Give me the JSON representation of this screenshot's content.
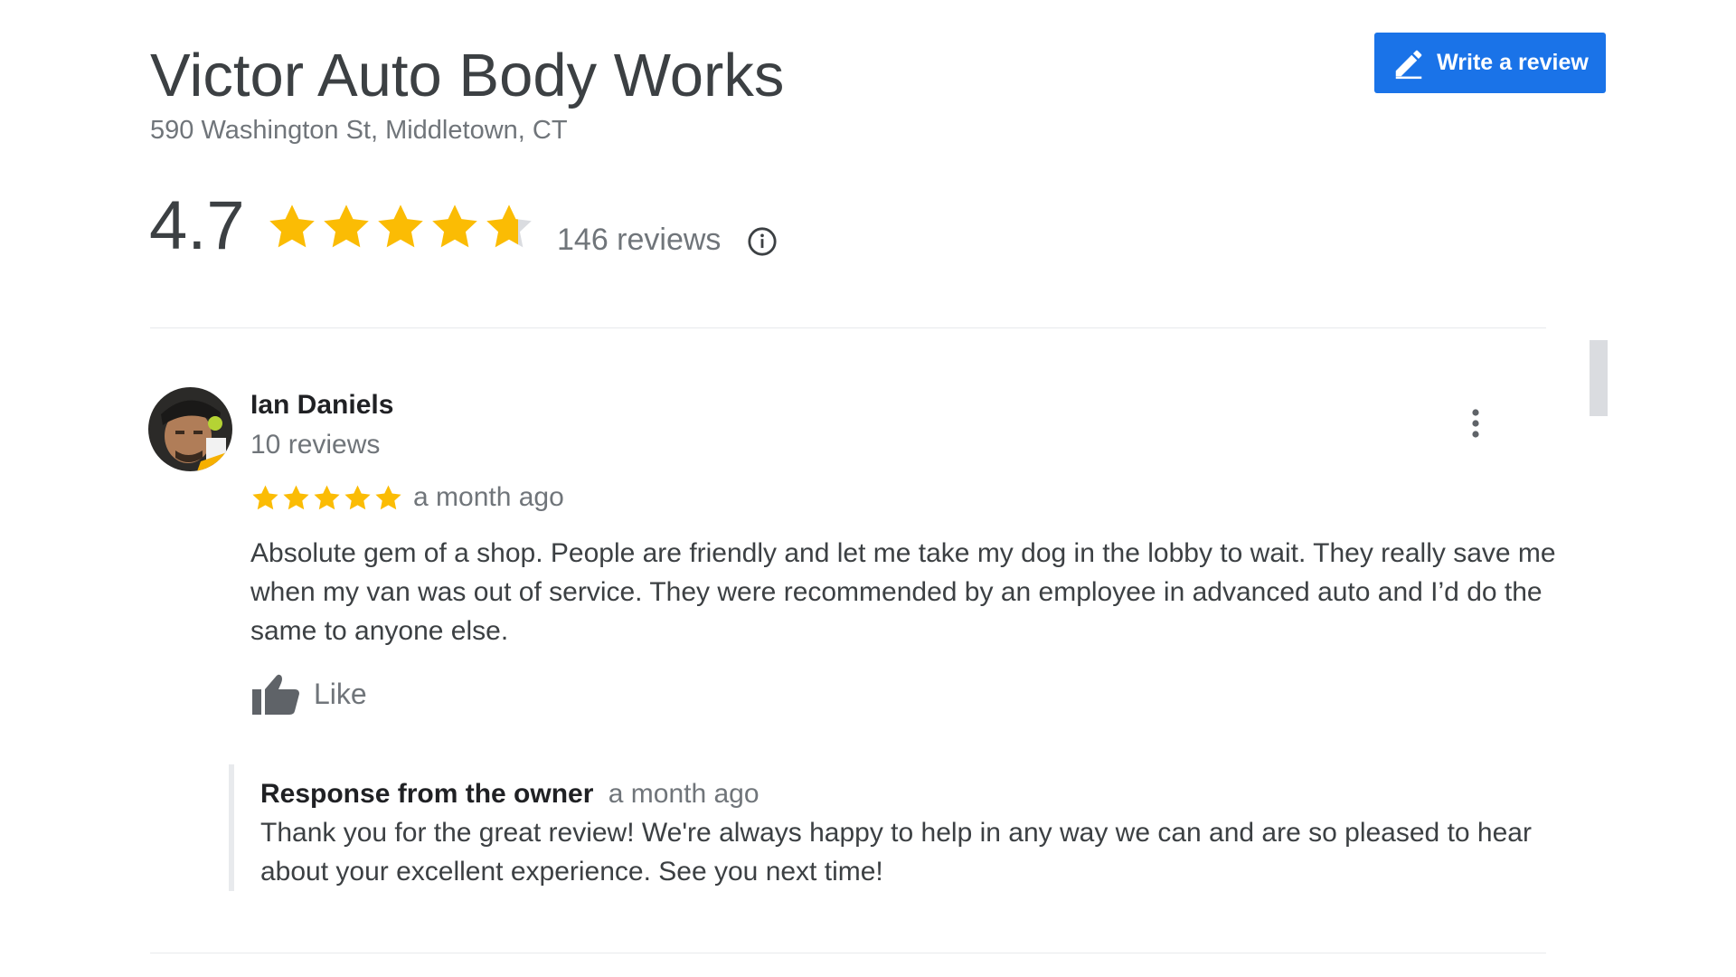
{
  "business": {
    "name": "Victor Auto Body Works",
    "address": "590 Washington St, Middletown, CT"
  },
  "write_review_button": {
    "label": "Write a review",
    "icon": "pencil-icon"
  },
  "summary": {
    "rating": "4.7",
    "rating_value": 4.7,
    "review_count": "146 reviews",
    "info_icon": "info-icon"
  },
  "colors": {
    "accent": "#1a73e8",
    "star": "#fbbc04",
    "star_empty": "#dadce0",
    "muted_text": "#70757a"
  },
  "review": {
    "reviewer_name": "Ian Daniels",
    "reviewer_reviews": "10 reviews",
    "rating_value": 5,
    "date": "a month ago",
    "text": "Absolute gem of a shop. People are friendly and let me take my dog in the lobby to wait. They really save me when my van was out of service. They were recommended by an employee in advanced auto and I’d do the same to anyone else.",
    "like_label": "Like",
    "more_icon": "more-vert-icon",
    "owner_response": {
      "title": "Response from the owner",
      "date": "a month ago",
      "text": "Thank you for the great review! We're always happy to help in any way we can and are so pleased to hear about your excellent experience. See you next time!"
    }
  }
}
